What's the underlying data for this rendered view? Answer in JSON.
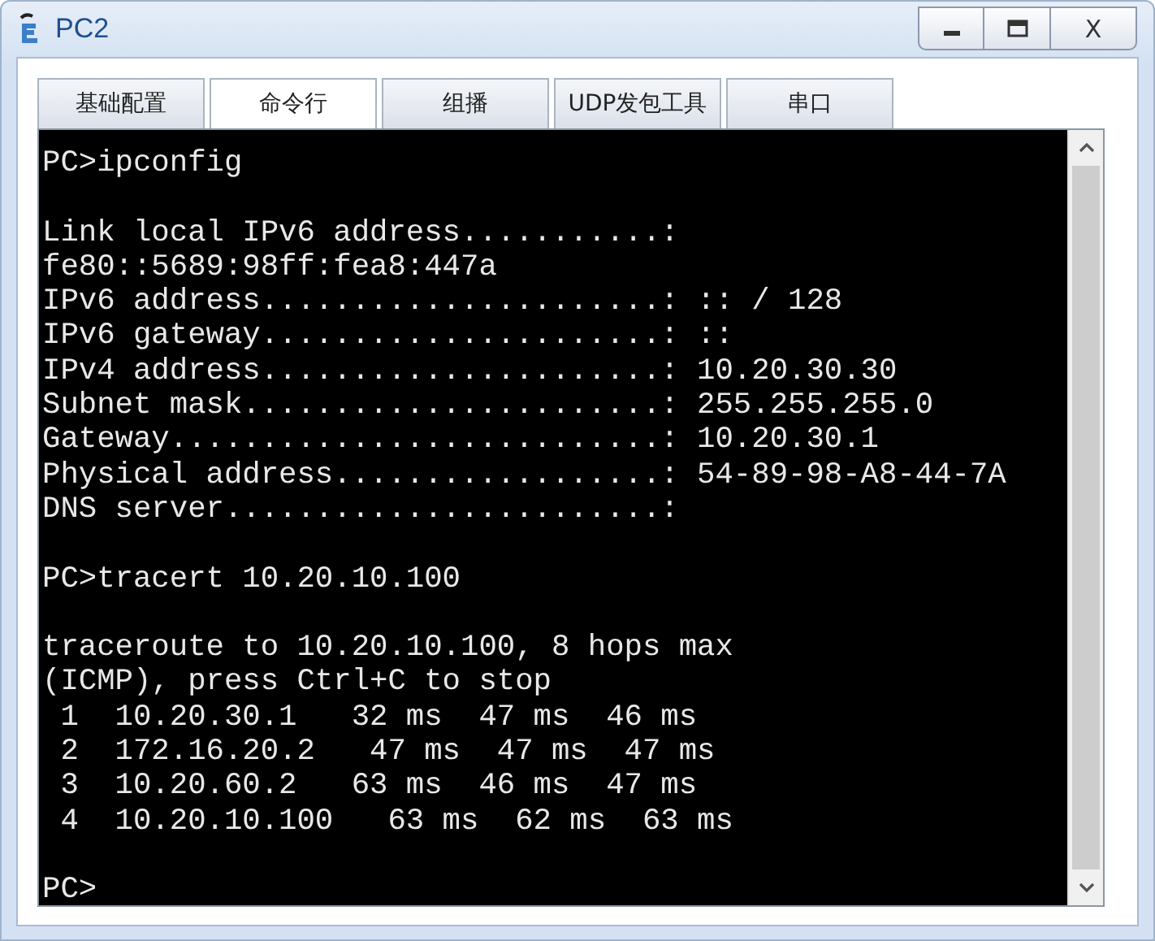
{
  "window": {
    "title": "PC2",
    "close_label": "X"
  },
  "tabs": [
    {
      "label": "基础配置",
      "selected": false
    },
    {
      "label": "命令行",
      "selected": true
    },
    {
      "label": "组播",
      "selected": false
    },
    {
      "label": "UDP发包工具",
      "selected": false
    },
    {
      "label": "串口",
      "selected": false
    }
  ],
  "terminal": {
    "blocks": [
      [
        "PC>ipconfig"
      ],
      [
        "Link local IPv6 address...........:",
        "fe80::5689:98ff:fea8:447a",
        "IPv6 address......................: :: / 128",
        "IPv6 gateway......................: ::",
        "IPv4 address......................: 10.20.30.30",
        "Subnet mask.......................: 255.255.255.0",
        "Gateway...........................: 10.20.30.1",
        "Physical address..................: 54-89-98-A8-44-7A",
        "DNS server........................:"
      ],
      [
        "PC>tracert 10.20.10.100"
      ],
      [
        "traceroute to 10.20.10.100, 8 hops max",
        "(ICMP), press Ctrl+C to stop",
        " 1  10.20.30.1   32 ms  47 ms  46 ms",
        " 2  172.16.20.2   47 ms  47 ms  47 ms",
        " 3  10.20.60.2   63 ms  46 ms  47 ms",
        " 4  10.20.10.100   63 ms  62 ms  63 ms"
      ],
      [
        "PC>"
      ]
    ]
  }
}
